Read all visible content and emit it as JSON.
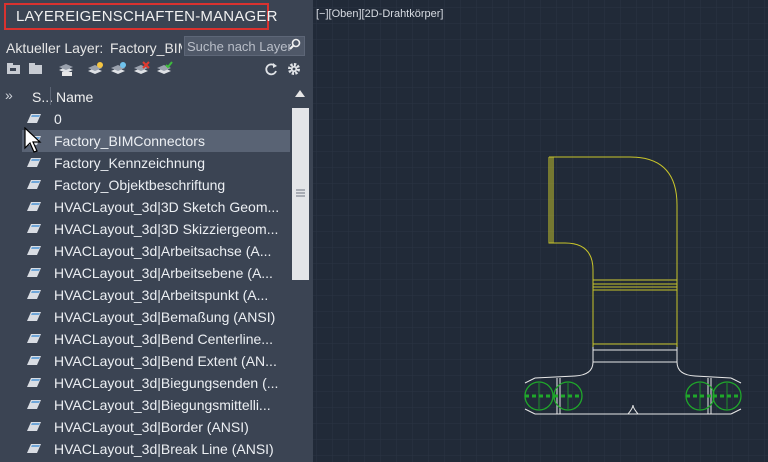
{
  "panel": {
    "title": "LAYEREIGENSCHAFTEN-MANAGER",
    "current_layer_label": "Aktueller Layer:",
    "current_layer_value": "Factory_BIMConnectors",
    "search": {
      "placeholder": "Suche nach Layer"
    },
    "toolbar_icons": [
      "new-property-filter-icon",
      "new-group-filter-icon",
      "layer-states-manager-icon",
      "new-layer-icon",
      "new-layer-vp-frozen-icon",
      "delete-layer-icon",
      "set-current-icon",
      "refresh-icon",
      "settings-icon"
    ],
    "columns": {
      "status": "S...",
      "name": "Name"
    },
    "layers": [
      "0",
      "Factory_BIMConnectors",
      "Factory_Kennzeichnung",
      "Factory_Objektbeschriftung",
      "HVACLayout_3d|3D Sketch Geom...",
      "HVACLayout_3d|3D Skizziergeom...",
      "HVACLayout_3d|Arbeitsachse (A...",
      "HVACLayout_3d|Arbeitsebene (A...",
      "HVACLayout_3d|Arbeitspunkt (A...",
      "HVACLayout_3d|Bemaßung (ANSI)",
      "HVACLayout_3d|Bend Centerline...",
      "HVACLayout_3d|Bend Extent (AN...",
      "HVACLayout_3d|Biegungsenden (...",
      "HVACLayout_3d|Biegungsmittelli...",
      "HVACLayout_3d|Border (ANSI)",
      "HVACLayout_3d|Break Line (ANSI)"
    ],
    "selected_index": 1
  },
  "viewport": {
    "label": "[−][Oben][2D-Drahtkörper]"
  },
  "colors": {
    "panel_bg": "#3b4453",
    "canvas_bg": "#212a38",
    "title_border": "#d9322f",
    "geometry_yellow": "#c9c52a",
    "geometry_white": "#e8e8e8",
    "connector_green": "#1fa82a"
  }
}
